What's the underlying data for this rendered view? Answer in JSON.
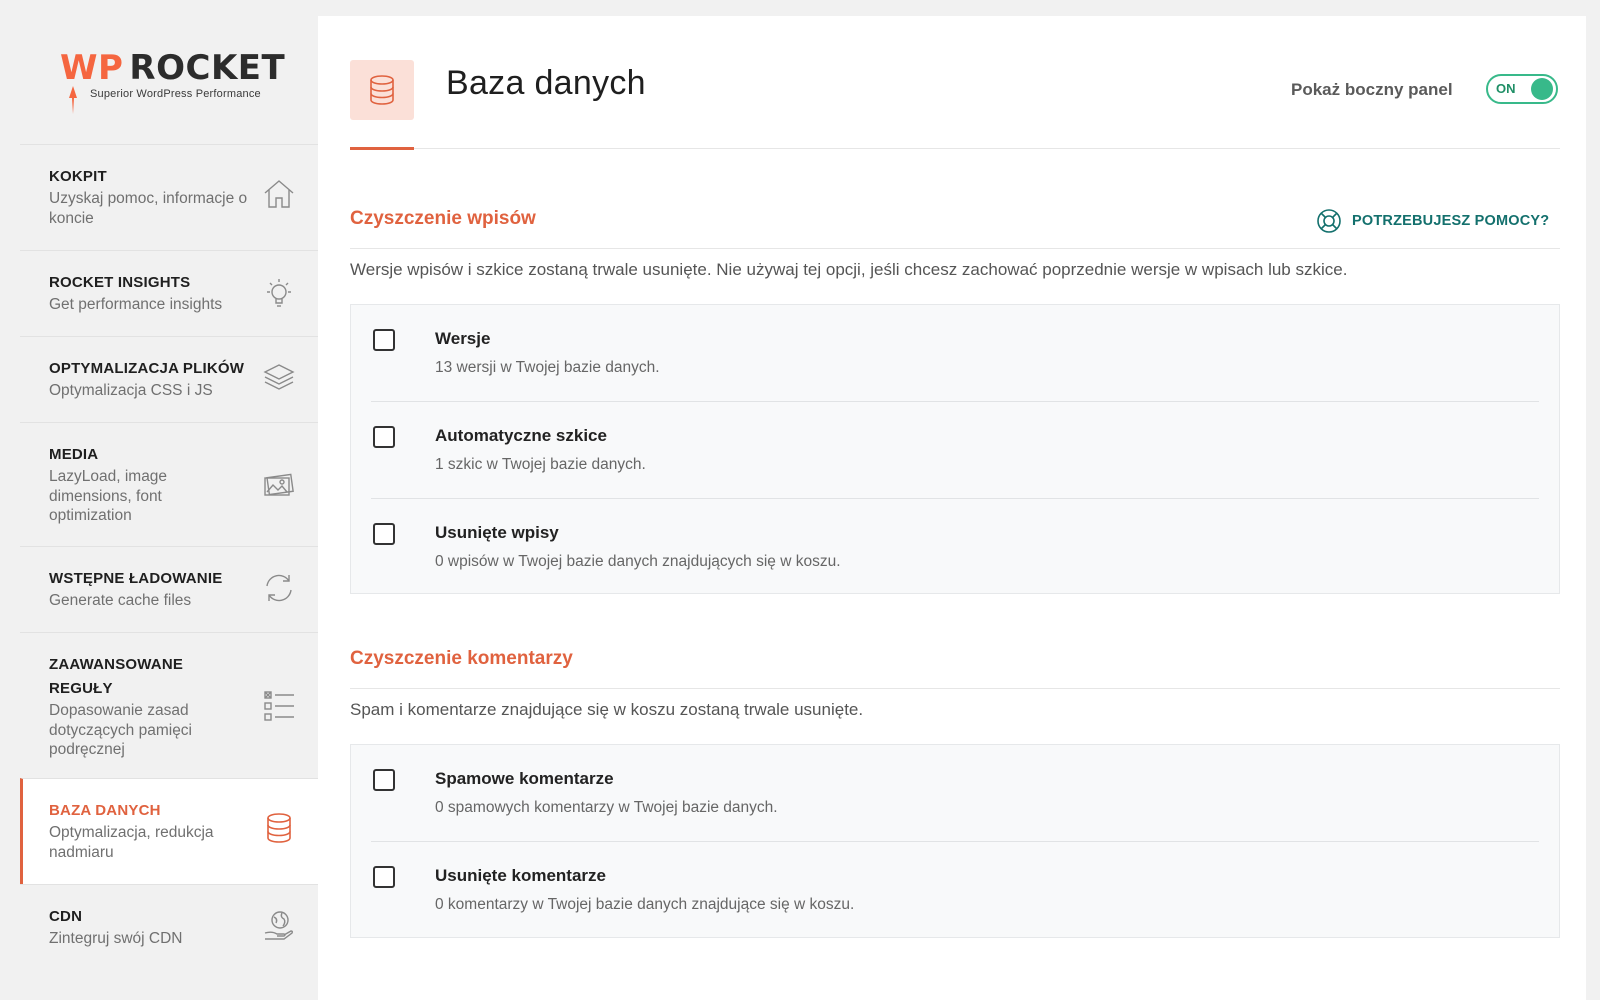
{
  "brand": {
    "logo_wp": "WP",
    "logo_rocket": "ROCKET",
    "tagline": "Superior WordPress Performance",
    "accent_color": "#e0623f",
    "link_color": "#13706d",
    "toggle_color": "#38b98a"
  },
  "sidebar": {
    "items": [
      {
        "title": "KOKPIT",
        "desc": "Uzyskaj pomoc, informacje o koncie",
        "icon": "home-icon"
      },
      {
        "title": "ROCKET INSIGHTS",
        "desc": "Get performance insights",
        "icon": "lightbulb-icon"
      },
      {
        "title": "OPTYMALIZACJA PLIKÓW",
        "desc": "Optymalizacja CSS i JS",
        "icon": "layers-icon"
      },
      {
        "title": "MEDIA",
        "desc": "LazyLoad, image dimensions, font optimization",
        "icon": "images-icon"
      },
      {
        "title": "WSTĘPNE ŁADOWANIE",
        "desc": "Generate cache files",
        "icon": "refresh-icon"
      },
      {
        "title": "ZAAWANSOWANE REGUŁY",
        "desc": "Dopasowanie zasad dotyczących pamięci podręcznej",
        "icon": "checklist-icon"
      },
      {
        "title": "BAZA DANYCH",
        "desc": "Optymalizacja, redukcja nadmiaru",
        "icon": "database-icon",
        "active": true
      },
      {
        "title": "CDN",
        "desc": "Zintegruj swój CDN",
        "icon": "globe-hand-icon"
      }
    ]
  },
  "header": {
    "title": "Baza danych",
    "toggle_label": "Pokaż boczny panel",
    "toggle_state": "ON"
  },
  "help": {
    "label": "POTRZEBUJESZ POMOCY?"
  },
  "posts_cleanup": {
    "title": "Czyszczenie wpisów",
    "desc": "Wersje wpisów i szkice zostaną trwale usunięte. Nie używaj tej opcji, jeśli chcesz zachować poprzednie wersje w wpisach lub szkice.",
    "options": [
      {
        "label": "Wersje",
        "desc": "13 wersji w Twojej bazie danych."
      },
      {
        "label": "Automatyczne szkice",
        "desc": "1 szkic w Twojej bazie danych."
      },
      {
        "label": "Usunięte wpisy",
        "desc": "0 wpisów w Twojej bazie danych znajdujących się w koszu."
      }
    ]
  },
  "comments_cleanup": {
    "title": "Czyszczenie komentarzy",
    "desc": "Spam i komentarze znajdujące się w koszu zostaną trwale usunięte.",
    "options": [
      {
        "label": "Spamowe komentarze",
        "desc": "0 spamowych komentarzy w Twojej bazie danych."
      },
      {
        "label": "Usunięte komentarze",
        "desc": "0 komentarzy w Twojej bazie danych znajdujące się w koszu."
      }
    ]
  }
}
